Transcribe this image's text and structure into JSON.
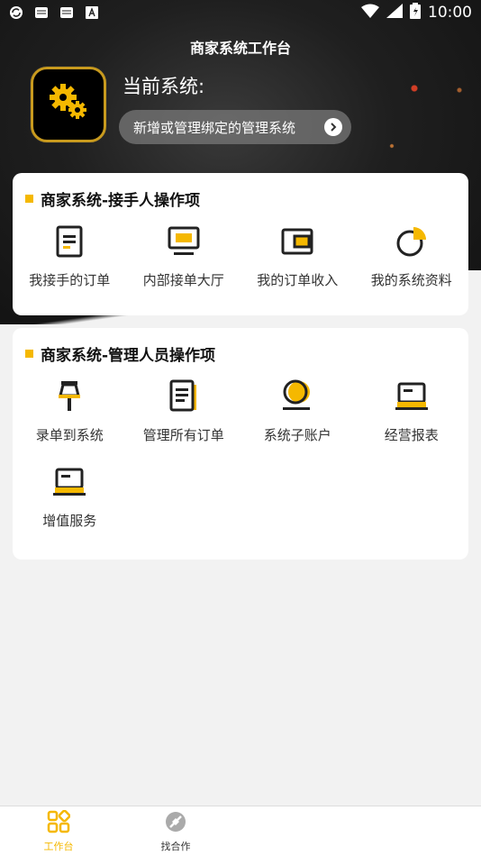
{
  "status_bar": {
    "time": "10:00",
    "left_icons": [
      "sync-icon",
      "mail-icon",
      "mail-icon",
      "font-icon"
    ],
    "right_icons": [
      "wifi-icon",
      "signal-icon",
      "battery-icon"
    ]
  },
  "header": {
    "title": "商家系统工作台",
    "current_system_label": "当前系统:",
    "bind_button_label": "新增或管理绑定的管理系统"
  },
  "colors": {
    "accent": "#f5b800",
    "dark": "#1a1a1a"
  },
  "section1": {
    "title": "商家系统-接手人操作项",
    "items": [
      {
        "label": "我接手的订单",
        "icon": "document-icon"
      },
      {
        "label": "内部接单大厅",
        "icon": "monitor-icon"
      },
      {
        "label": "我的订单收入",
        "icon": "wallet-icon"
      },
      {
        "label": "我的系统资料",
        "icon": "pie-chart-icon"
      }
    ]
  },
  "section2": {
    "title": "商家系统-管理人员操作项",
    "items": [
      {
        "label": "录单到系统",
        "icon": "pushpin-icon"
      },
      {
        "label": "管理所有订单",
        "icon": "notes-icon"
      },
      {
        "label": "系统子账户",
        "icon": "user-icon"
      },
      {
        "label": "经营报表",
        "icon": "laptop-icon"
      },
      {
        "label": "增值服务",
        "icon": "laptop-icon"
      }
    ]
  },
  "tabbar": {
    "tabs": [
      {
        "label": "工作台",
        "icon": "grid-icon",
        "active": true
      },
      {
        "label": "找合作",
        "icon": "compass-icon",
        "active": false
      }
    ]
  }
}
